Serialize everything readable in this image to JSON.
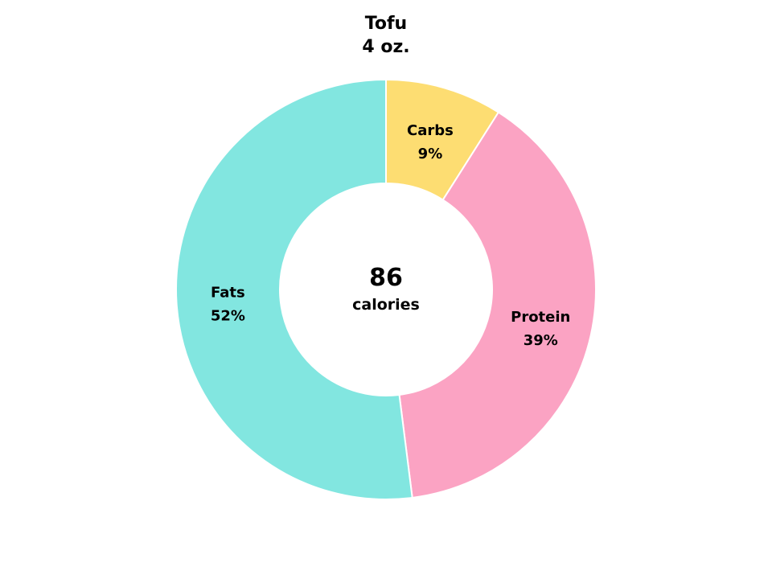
{
  "chart_data": {
    "type": "pie",
    "title": "Tofu",
    "subtitle": "4 oz.",
    "center_value": "86",
    "center_label": "calories",
    "start_angle": 0,
    "slices": [
      {
        "name": "Carbs",
        "value": 9,
        "label": "9%",
        "color": "#fddd72"
      },
      {
        "name": "Protein",
        "value": 39,
        "label": "39%",
        "color": "#fba3c3"
      },
      {
        "name": "Fats",
        "value": 52,
        "label": "52%",
        "color": "#82e6e0"
      }
    ],
    "legend": "none",
    "grid": false
  }
}
